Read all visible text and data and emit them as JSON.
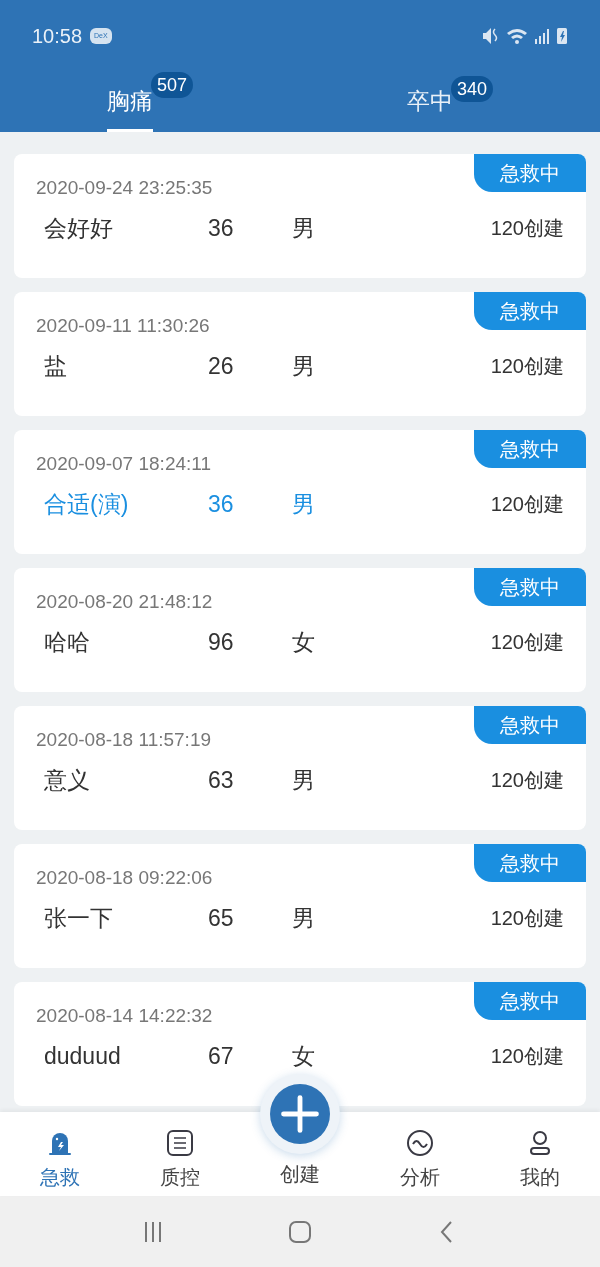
{
  "status_bar": {
    "time": "10:58",
    "badge": "DeX"
  },
  "tabs": [
    {
      "label": "胸痛",
      "count": "507",
      "selected": true
    },
    {
      "label": "卒中",
      "count": "340",
      "selected": false
    }
  ],
  "records": [
    {
      "time": "2020-09-24 23:25:35",
      "name": "会好好",
      "age": "36",
      "sex": "男",
      "source": "120创建",
      "status": "急救中",
      "selected": false
    },
    {
      "time": "2020-09-11 11:30:26",
      "name": "盐",
      "age": "26",
      "sex": "男",
      "source": "120创建",
      "status": "急救中",
      "selected": false
    },
    {
      "time": "2020-09-07 18:24:11",
      "name": "合适(演)",
      "age": "36",
      "sex": "男",
      "source": "120创建",
      "status": "急救中",
      "selected": true
    },
    {
      "time": "2020-08-20 21:48:12",
      "name": "哈哈",
      "age": "96",
      "sex": "女",
      "source": "120创建",
      "status": "急救中",
      "selected": false
    },
    {
      "time": "2020-08-18 11:57:19",
      "name": "意义",
      "age": "63",
      "sex": "男",
      "source": "120创建",
      "status": "急救中",
      "selected": false
    },
    {
      "time": "2020-08-18 09:22:06",
      "name": "张一下",
      "age": "65",
      "sex": "男",
      "source": "120创建",
      "status": "急救中",
      "selected": false
    },
    {
      "time": "2020-08-14 14:22:32",
      "name": "duduud",
      "age": "67",
      "sex": "女",
      "source": "120创建",
      "status": "急救中",
      "selected": false
    }
  ],
  "bottom_nav": [
    {
      "kind": "siren",
      "label": "急救",
      "selected": true
    },
    {
      "kind": "list",
      "label": "质控",
      "selected": false
    },
    {
      "kind": "add",
      "label": "创建",
      "selected": false
    },
    {
      "kind": "chart",
      "label": "分析",
      "selected": false
    },
    {
      "kind": "user",
      "label": "我的",
      "selected": false
    }
  ]
}
